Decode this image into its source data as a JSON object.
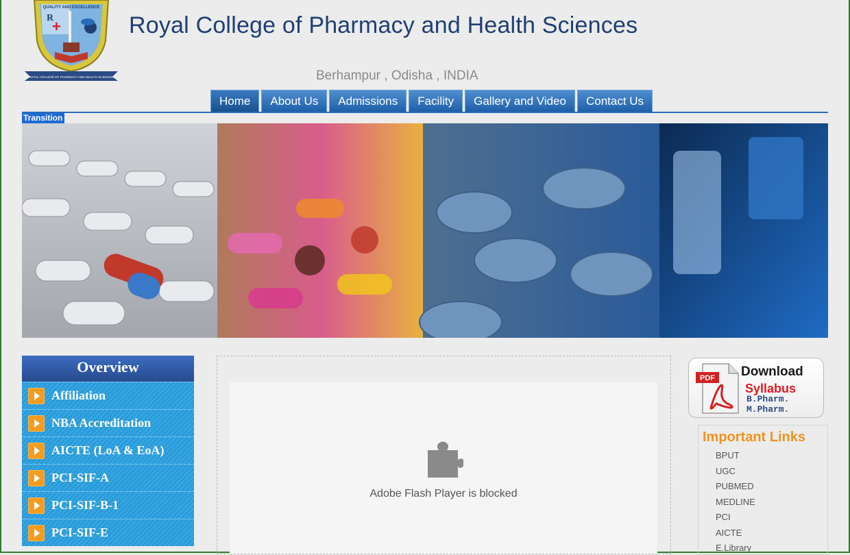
{
  "header": {
    "title": "Royal College of Pharmacy and Health Sciences",
    "subtitle": "Berhampur , Odisha , INDIA",
    "logo_text": "QUALITY AND EXCELLENCE",
    "logo_banner": "ROYAL COLLEGE OF PHARMACY AND HEALTH SCIENCES"
  },
  "nav": [
    {
      "label": "Home",
      "active": true
    },
    {
      "label": "About Us"
    },
    {
      "label": "Admissions"
    },
    {
      "label": "Facility"
    },
    {
      "label": "Gallery and Video"
    },
    {
      "label": "Contact Us"
    }
  ],
  "banner": {
    "transition_label": "Transition"
  },
  "overview": {
    "title": "Overview",
    "items": [
      "Affiliation",
      "NBA Accreditation",
      "AICTE (LoA & EoA)",
      "PCI-SIF-A",
      "PCI-SIF-B-1",
      "PCI-SIF-E"
    ]
  },
  "flash": {
    "message": "Adobe Flash Player is blocked"
  },
  "download": {
    "pdf_label": "PDF",
    "title": "Download",
    "subtitle": "Syllabus",
    "line1": "B.Pharm.",
    "line2": "M.Pharm."
  },
  "important_links": {
    "title": "Important Links",
    "items": [
      "BPUT",
      "UGC",
      "PUBMED",
      "MEDLINE",
      "PCI",
      "AICTE",
      "E.Library"
    ]
  },
  "colors": {
    "title_blue": "#1f3f75",
    "nav_blue": "#1f5fa8",
    "overview_blue": "#2a9ad8",
    "arrow_orange": "#f49c20",
    "links_orange": "#f0931e",
    "pdf_red": "#e01b24",
    "page_bg": "#ebeceb"
  }
}
